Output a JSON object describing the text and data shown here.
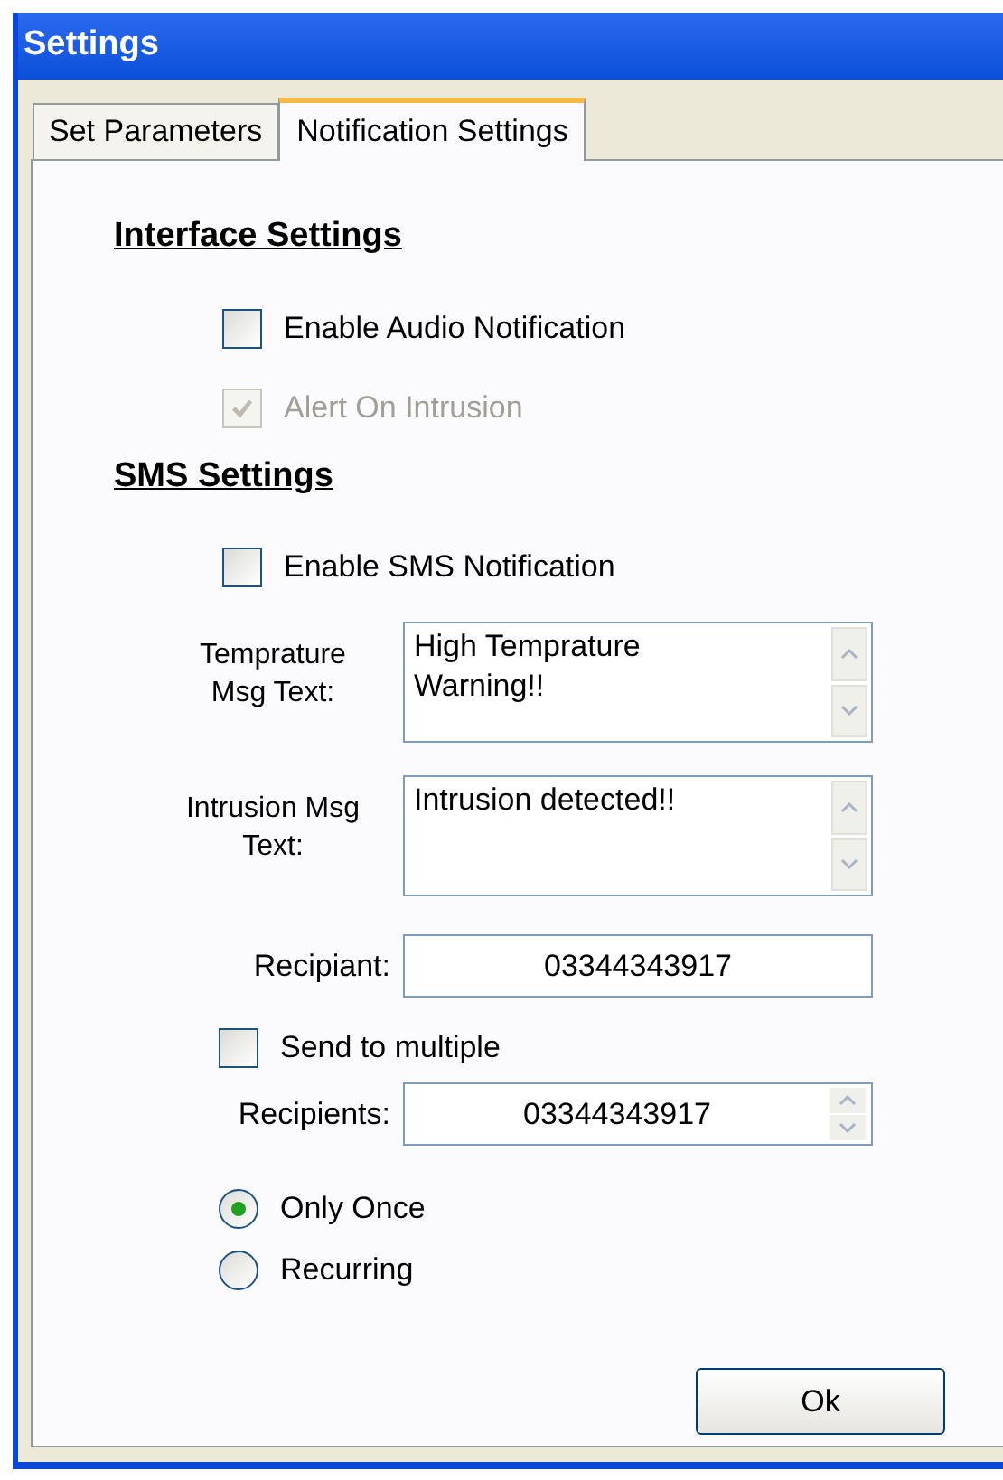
{
  "window": {
    "title": "Settings"
  },
  "tabs": [
    {
      "label": "Set Parameters",
      "selected": false
    },
    {
      "label": "Notification Settings",
      "selected": true
    }
  ],
  "sections": [
    {
      "heading": "Interface Settings",
      "items": [
        {
          "kind": "checkbox",
          "label": "Enable Audio Notification",
          "checked": false,
          "disabled": false
        },
        {
          "kind": "checkbox",
          "label": "Alert On Intrusion",
          "checked": true,
          "disabled": true
        }
      ]
    },
    {
      "heading": "SMS Settings",
      "items": [
        {
          "kind": "checkbox",
          "label": "Enable SMS Notification",
          "checked": false,
          "disabled": false
        },
        {
          "kind": "textarea",
          "label": "Temprature Msg Text:",
          "value": "High Temprature Warning!!"
        },
        {
          "kind": "textarea",
          "label": "Intrusion Msg Text:",
          "value": "Intrusion detected!!"
        },
        {
          "kind": "textbox",
          "label": "Recipiant:",
          "value": "03344343917"
        },
        {
          "kind": "checkbox",
          "label": "Send to multiple",
          "checked": false,
          "disabled": false
        },
        {
          "kind": "spinner",
          "label": "Recipients:",
          "value": "03344343917"
        },
        {
          "kind": "radio",
          "label": "Only Once",
          "selected": true
        },
        {
          "kind": "radio",
          "label": "Recurring",
          "selected": false
        }
      ]
    }
  ],
  "buttons": [
    "Ok"
  ]
}
